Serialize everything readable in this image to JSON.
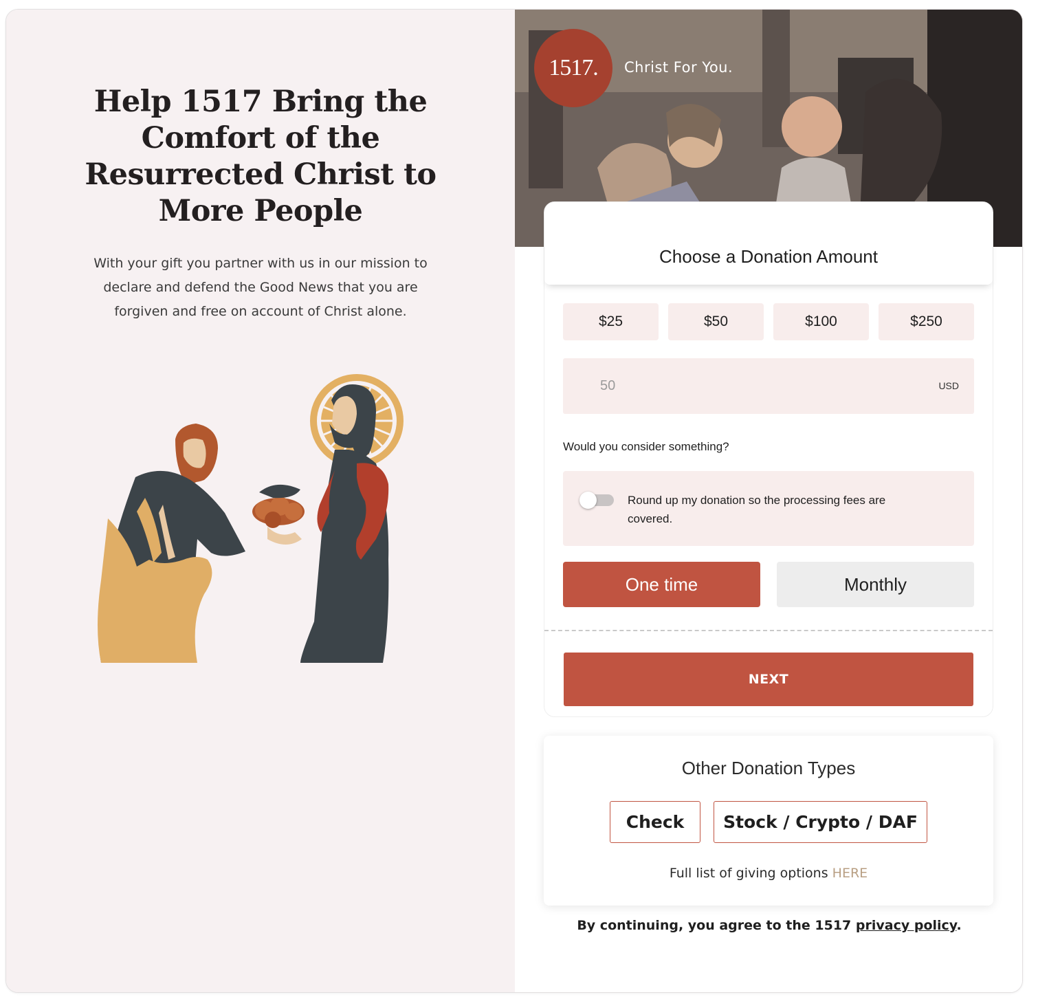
{
  "left": {
    "headline": "Help 1517 Bring the Comfort of the Resurrected Christ to More People",
    "subtext": "With your gift you partner with us in our mission to declare and defend the Good News that you are forgiven and free on account of Christ alone."
  },
  "hero": {
    "logo_text": "1517.",
    "tagline": "Christ For You."
  },
  "donation": {
    "title": "Choose a Donation Amount",
    "amounts": [
      "$25",
      "$50",
      "$100",
      "$250"
    ],
    "amount_value": "",
    "amount_placeholder": "50",
    "currency": "USD",
    "consider_label": "Would you consider something?",
    "roundup_text": "Round up my donation so the processing fees are covered.",
    "roundup_enabled": false,
    "frequency_options": [
      "One time",
      "Monthly"
    ],
    "frequency_selected": "One time",
    "next_label": "NEXT"
  },
  "other_types": {
    "title": "Other Donation Types",
    "buttons": [
      "Check",
      "Stock / Crypto / DAF"
    ],
    "full_list_text": "Full list of giving options",
    "full_list_link": "HERE"
  },
  "footer": {
    "agree_prefix": "By continuing, you agree to the 1517",
    "privacy_link": "privacy policy",
    "agree_suffix": "."
  },
  "colors": {
    "accent": "#c05441",
    "logo": "#a5412f",
    "left_bg": "#f7f1f2",
    "amount_bg": "#f8edec",
    "link_gold": "#b89f83"
  }
}
